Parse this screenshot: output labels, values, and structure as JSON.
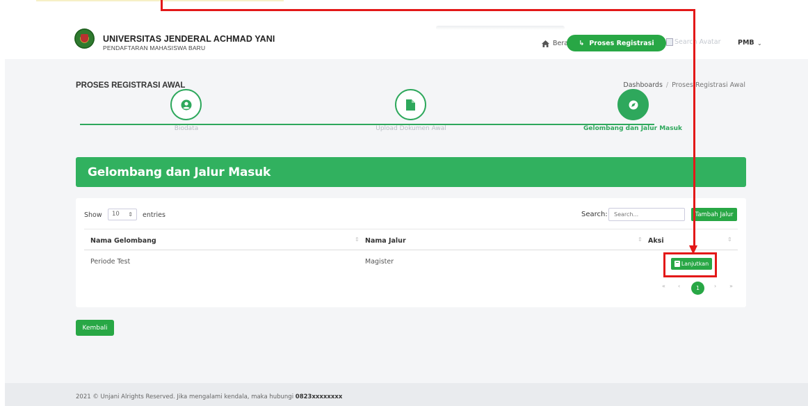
{
  "header": {
    "university_name": "UNIVERSITAS JENDERAL ACHMAD YANI",
    "university_sub": "PENDAFTARAN MAHASISWA BARU",
    "nav_beranda": "Beranda",
    "btn_proses": "Proses Registrasi",
    "avatar_alt": "Search Avatar",
    "user_name": "PMB"
  },
  "page": {
    "title": "PROSES REGISTRASI AWAL",
    "breadcrumb": [
      "Dashboards",
      "Proses Registrasi Awal"
    ]
  },
  "steps": [
    {
      "label": "Biodata",
      "icon": "user-circle-icon",
      "active": false
    },
    {
      "label": "Upload Dokumen Awal",
      "icon": "file-icon",
      "active": false
    },
    {
      "label": "Gelombang dan Jalur Masuk",
      "icon": "compass-icon",
      "active": true
    }
  ],
  "section": {
    "title": "Gelombang dan Jalur Masuk"
  },
  "table": {
    "show_label": "Show",
    "page_length": "10",
    "entries_label": "entries",
    "search_label": "Search:",
    "search_placeholder": "Search...",
    "add_button": "Tambah Jalur",
    "columns": [
      "Nama Gelombang",
      "Nama Jalur",
      "Aksi"
    ],
    "rows": [
      {
        "gelombang": "Periode Test",
        "jalur": "Magister",
        "action": "Lanjutkan"
      }
    ],
    "pagination": {
      "first": "«",
      "prev": "‹",
      "current": "1",
      "next": "›",
      "last": "»"
    }
  },
  "back_button": "Kembali",
  "footer": {
    "text": "2021 © Unjani Alrights Reserved. Jika mengalami kendala, maka hubungi ",
    "phone": "0823xxxxxxxx"
  },
  "colors": {
    "brand_green": "#28a745",
    "annotation_red": "#e31818"
  }
}
